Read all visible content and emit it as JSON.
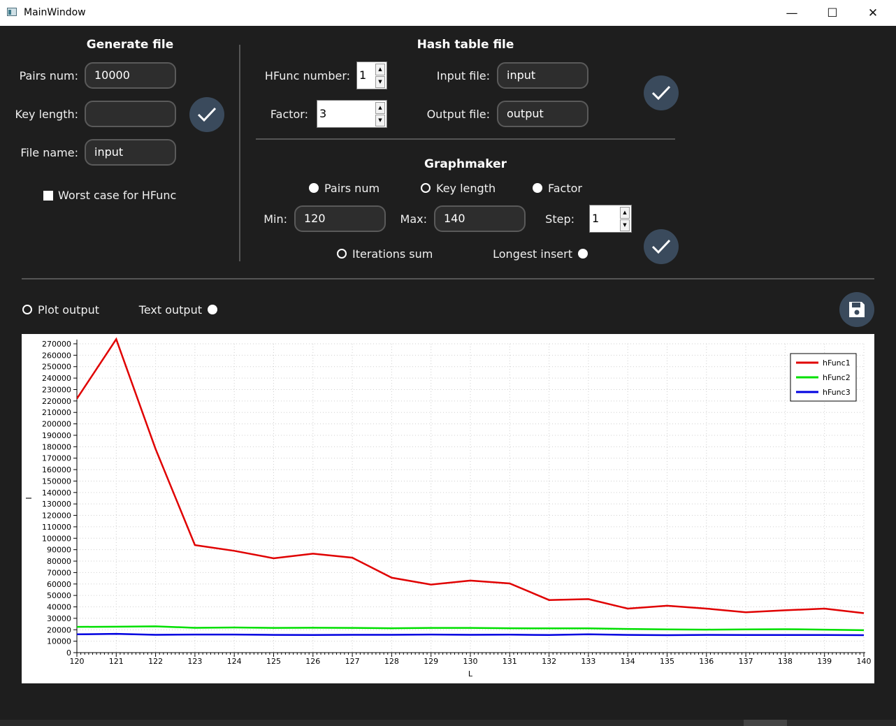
{
  "window": {
    "title": "MainWindow",
    "minimize": "—",
    "maximize": "☐",
    "close": "✕"
  },
  "generate": {
    "heading": "Generate file",
    "pairs_label": "Pairs num:",
    "pairs_value": "10000",
    "key_label": "Key length:",
    "key_value": "",
    "file_label": "File name:",
    "file_value": "input",
    "worst_case_label": "Worst case for HFunc",
    "worst_case_checked": true
  },
  "hash": {
    "heading": "Hash table file",
    "hfunc_label": "HFunc number:",
    "hfunc_value": "1",
    "factor_label": "Factor:",
    "factor_value": "3",
    "input_label": "Input file:",
    "input_value": "input",
    "output_label": "Output file:",
    "output_value": "output"
  },
  "graphmaker": {
    "heading": "Graphmaker",
    "radio_pairs": "Pairs num",
    "radio_key": "Key length",
    "radio_factor": "Factor",
    "selected_param": "Key length",
    "min_label": "Min:",
    "min_value": "120",
    "max_label": "Max:",
    "max_value": "140",
    "step_label": "Step:",
    "step_value": "1",
    "iter_label": "Iterations sum",
    "longest_label": "Longest insert",
    "selected_metric": "Iterations sum"
  },
  "output": {
    "plot_label": "Plot output",
    "text_label": "Text output",
    "selected": "Plot output"
  },
  "icons": {
    "ok": "check-icon",
    "save": "floppy-disk-icon"
  },
  "colors": {
    "accent_button": "#3a4a5c",
    "hFunc1": "#e00000",
    "hFunc2": "#00e000",
    "hFunc3": "#0000e0"
  },
  "chart_data": {
    "type": "line",
    "xlabel": "L",
    "ylabel": "I",
    "xlim": [
      120,
      140
    ],
    "ylim": [
      0,
      270000
    ],
    "x_ticks": [
      120,
      121,
      122,
      123,
      124,
      125,
      126,
      127,
      128,
      129,
      130,
      131,
      132,
      133,
      134,
      135,
      136,
      137,
      138,
      139,
      140
    ],
    "y_ticks": [
      0,
      10000,
      20000,
      30000,
      40000,
      50000,
      60000,
      70000,
      80000,
      90000,
      100000,
      110000,
      120000,
      130000,
      140000,
      150000,
      160000,
      170000,
      180000,
      190000,
      200000,
      210000,
      220000,
      230000,
      240000,
      250000,
      260000,
      270000
    ],
    "grid": true,
    "legend_position": "top-right",
    "x": [
      120,
      121,
      122,
      123,
      124,
      125,
      126,
      127,
      128,
      129,
      130,
      131,
      132,
      133,
      134,
      135,
      136,
      137,
      138,
      139,
      140
    ],
    "series": [
      {
        "name": "hFunc1",
        "color": "#e00000",
        "values": [
          222000,
          274000,
          178000,
          94000,
          89000,
          82500,
          86500,
          83000,
          65500,
          59500,
          63000,
          60500,
          46000,
          46800,
          38500,
          41000,
          38500,
          35300,
          37000,
          38500,
          34500
        ]
      },
      {
        "name": "hFunc2",
        "color": "#00e000",
        "values": [
          22500,
          22700,
          23000,
          21700,
          22000,
          21600,
          21800,
          21600,
          21300,
          21600,
          21600,
          21300,
          21200,
          21200,
          20700,
          20300,
          20100,
          20300,
          20500,
          20100,
          19600
        ]
      },
      {
        "name": "hFunc3",
        "color": "#0000e0",
        "values": [
          16000,
          16400,
          15600,
          15800,
          15800,
          15500,
          15400,
          15600,
          15600,
          15800,
          15600,
          15700,
          15400,
          16000,
          15500,
          15300,
          15500,
          15400,
          15400,
          15400,
          15300
        ]
      }
    ]
  }
}
